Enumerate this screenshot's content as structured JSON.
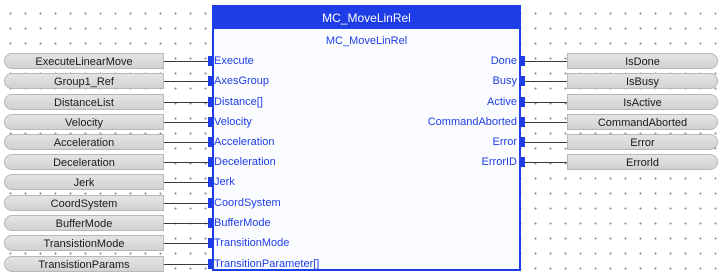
{
  "block": {
    "title": "MC_MoveLinRel",
    "type_name": "MC_MoveLinRel"
  },
  "inputs": [
    {
      "pin": "Execute",
      "variable": "ExecuteLinearMove"
    },
    {
      "pin": "AxesGroup",
      "variable": "Group1_Ref"
    },
    {
      "pin": "Distance[]",
      "variable": "DistanceList"
    },
    {
      "pin": "Velocity",
      "variable": "Velocity"
    },
    {
      "pin": "Acceleration",
      "variable": "Acceleration"
    },
    {
      "pin": "Deceleration",
      "variable": "Deceleration"
    },
    {
      "pin": "Jerk",
      "variable": "Jerk"
    },
    {
      "pin": "CoordSystem",
      "variable": "CoordSystem"
    },
    {
      "pin": "BufferMode",
      "variable": "BufferMode"
    },
    {
      "pin": "TransitionMode",
      "variable": "TransistionMode"
    },
    {
      "pin": "TransitionParameter[]",
      "variable": "TransistionParams"
    }
  ],
  "outputs": [
    {
      "pin": "Done",
      "variable": "IsDone"
    },
    {
      "pin": "Busy",
      "variable": "IsBusy"
    },
    {
      "pin": "Active",
      "variable": "IsActive"
    },
    {
      "pin": "CommandAborted",
      "variable": "CommandAborted"
    },
    {
      "pin": "Error",
      "variable": "Error"
    },
    {
      "pin": "ErrorID",
      "variable": "Errorld"
    }
  ],
  "colors": {
    "block_border": "#1e3de6",
    "pin_text": "#1e3de6",
    "variable_fill": "#d9d9d9"
  }
}
